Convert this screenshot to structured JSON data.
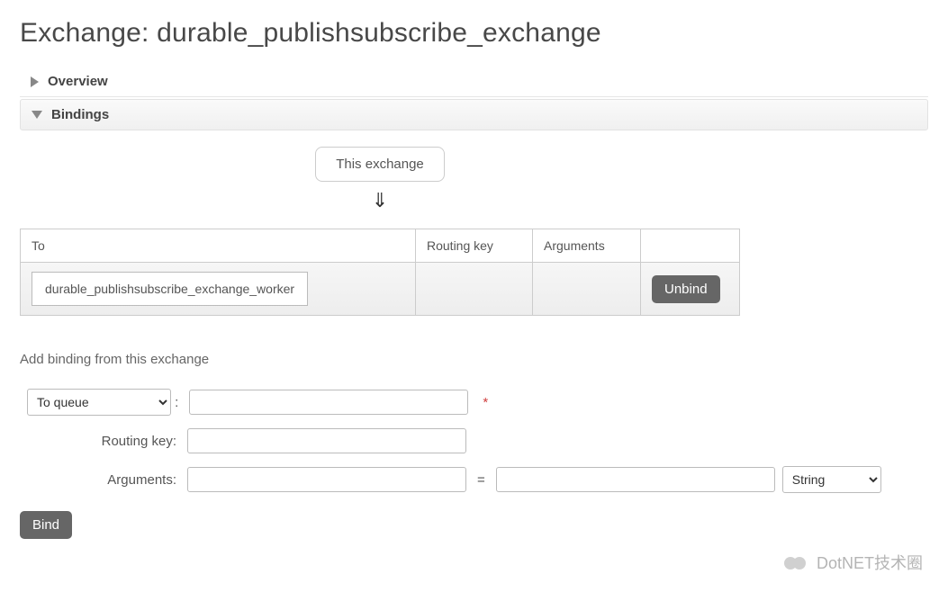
{
  "page": {
    "title_prefix": "Exchange: ",
    "exchange_name": "durable_publishsubscribe_exchange"
  },
  "sections": {
    "overview": {
      "label": "Overview",
      "expanded": false
    },
    "bindings": {
      "label": "Bindings",
      "expanded": true
    }
  },
  "bindings_panel": {
    "this_exchange_label": "This exchange",
    "arrow": "⇓",
    "table": {
      "headers": {
        "to": "To",
        "routing_key": "Routing key",
        "arguments": "Arguments"
      },
      "rows": [
        {
          "destination": "durable_publishsubscribe_exchange_worker",
          "routing_key": "",
          "arguments": "",
          "unbind_label": "Unbind"
        }
      ]
    }
  },
  "add_binding": {
    "title": "Add binding from this exchange",
    "to_queue_option": "To queue",
    "colon": ":",
    "destination_value": "",
    "routing_key_label": "Routing key:",
    "routing_key_value": "",
    "arguments_label": "Arguments:",
    "arg_key": "",
    "arg_value": "",
    "arg_type_option": "String",
    "bind_label": "Bind"
  },
  "watermark": {
    "text": "DotNET技术圈"
  }
}
